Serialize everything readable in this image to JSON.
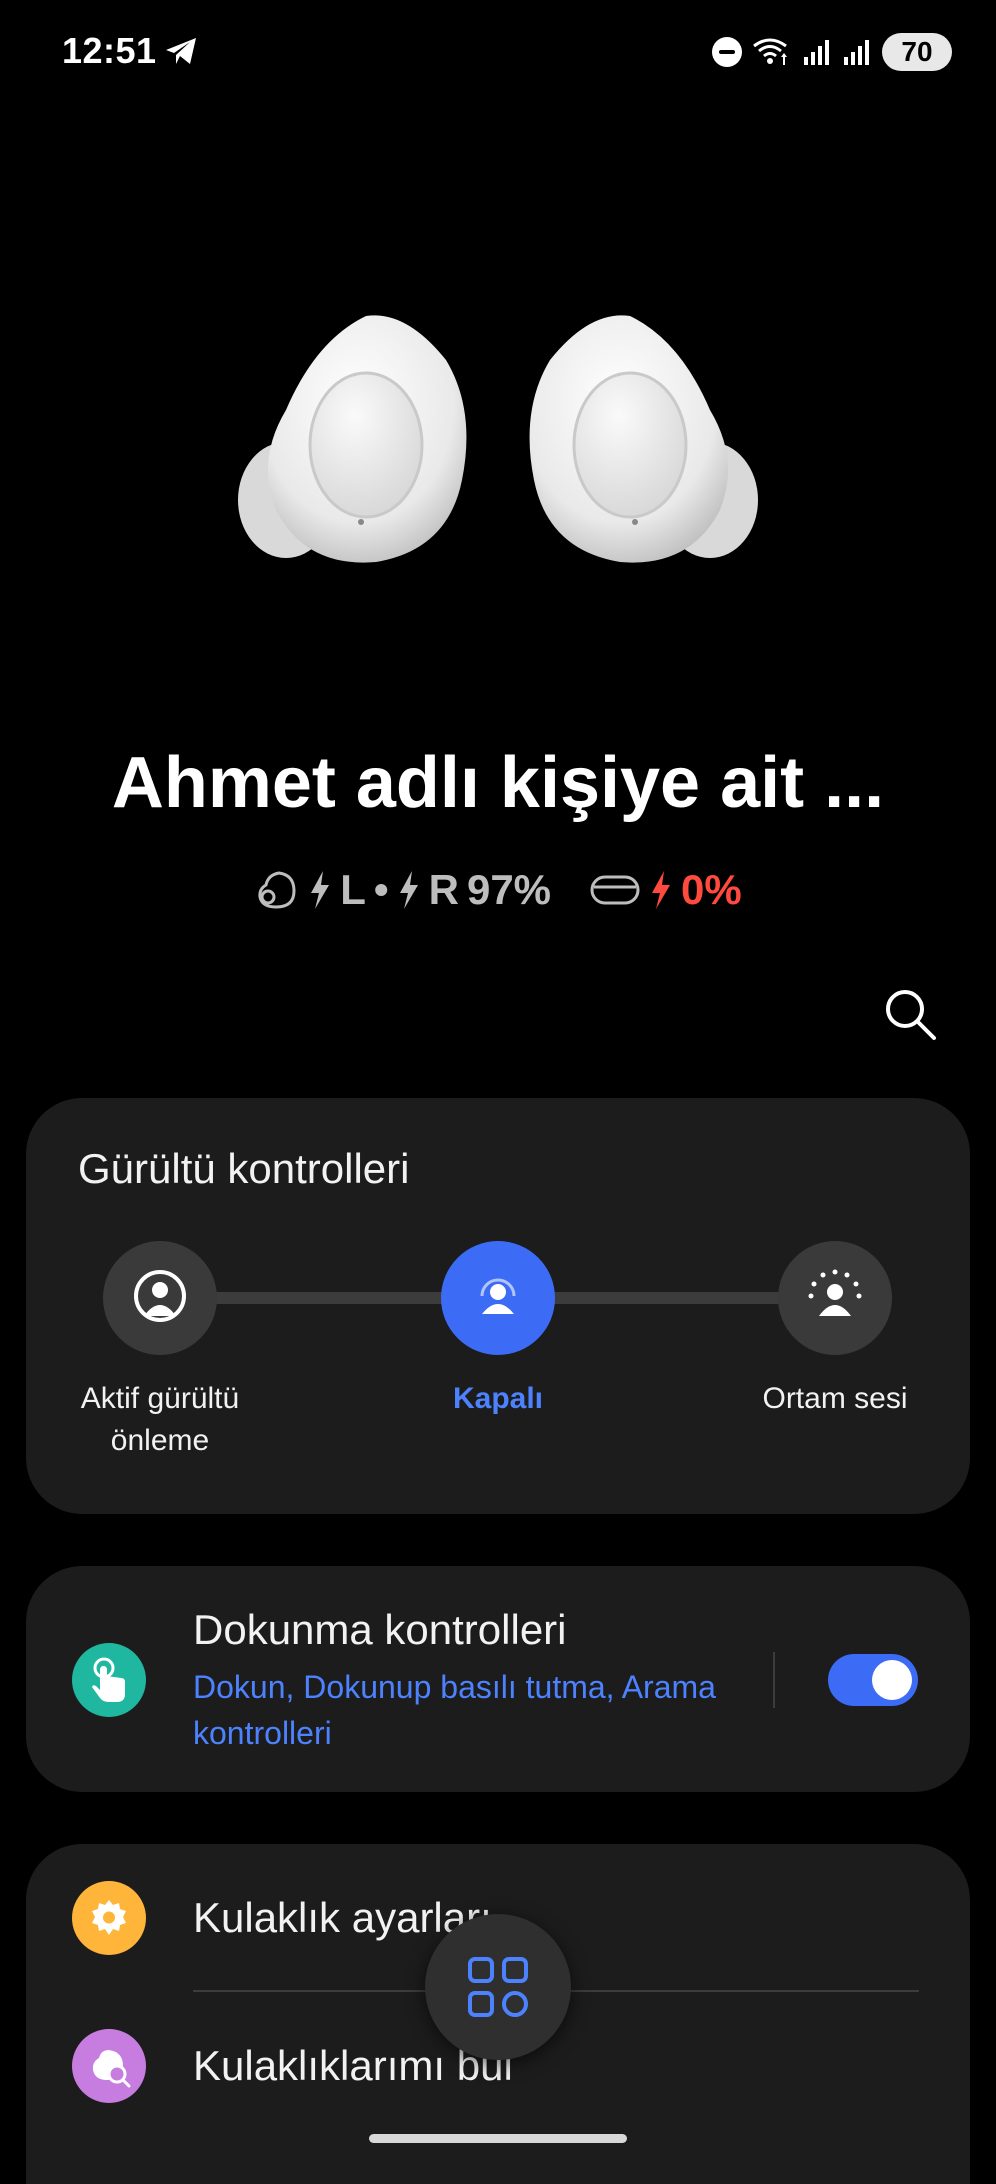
{
  "status_bar": {
    "time": "12:51",
    "battery_level": "70",
    "icons": [
      "telegram-icon",
      "do-not-disturb-icon",
      "wifi-icon",
      "signal-icon",
      "signal-icon"
    ]
  },
  "device": {
    "name": "Ahmet adlı kişiye ait ...",
    "earbuds_letters": {
      "left": "L",
      "separator": "•",
      "right": "R"
    },
    "earbuds_battery": "97%",
    "case_battery": "0%"
  },
  "noise_controls": {
    "title": "Gürültü kontrolleri",
    "modes": [
      {
        "label": "Aktif gürültü önleme",
        "active": false
      },
      {
        "label": "Kapalı",
        "active": true
      },
      {
        "label": "Ortam sesi",
        "active": false
      }
    ]
  },
  "touch_controls": {
    "title": "Dokunma kontrolleri",
    "subtitle": "Dokun, Dokunup basılı tutma, Arama kontrolleri",
    "enabled": true
  },
  "settings": {
    "items": [
      {
        "label": "Kulaklık ayarları",
        "icon": "gear-icon"
      },
      {
        "label": "Kulaklıklarımı bul",
        "icon": "find-earbuds-icon"
      }
    ]
  },
  "colors": {
    "accent": "#3c6cf6",
    "accent_text": "#4d82ff",
    "warning": "#ff4a3d",
    "touch_icon_bg": "#1fb79f",
    "settings_icon_bg": "#ffb43a",
    "find_icon_bg": "#c77de0"
  }
}
